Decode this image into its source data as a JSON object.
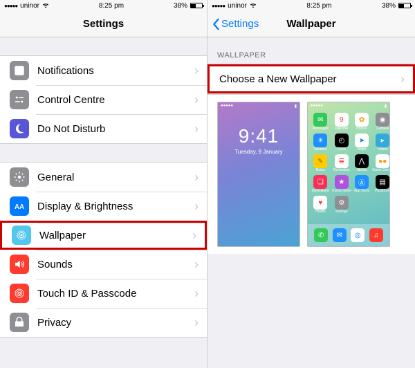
{
  "status": {
    "carrier": "uninor",
    "time": "8:25 pm",
    "battery_pct": "38%"
  },
  "left": {
    "title": "Settings",
    "group1": [
      {
        "label": "Notifications",
        "icon": "notifications-icon",
        "bg": "#8e8e93"
      },
      {
        "label": "Control Centre",
        "icon": "control-centre-icon",
        "bg": "#8e8e93"
      },
      {
        "label": "Do Not Disturb",
        "icon": "dnd-icon",
        "bg": "#5856d6"
      }
    ],
    "group2": [
      {
        "label": "General",
        "icon": "general-icon",
        "bg": "#8e8e93"
      },
      {
        "label": "Display & Brightness",
        "icon": "display-icon",
        "bg": "#007aff"
      },
      {
        "label": "Wallpaper",
        "icon": "wallpaper-icon",
        "bg": "#54c7ec",
        "highlight": true
      },
      {
        "label": "Sounds",
        "icon": "sounds-icon",
        "bg": "#ff3b30"
      },
      {
        "label": "Touch ID & Passcode",
        "icon": "touchid-icon",
        "bg": "#ff3b30"
      },
      {
        "label": "Privacy",
        "icon": "privacy-icon",
        "bg": "#8e8e93"
      }
    ]
  },
  "right": {
    "back_label": "Settings",
    "title": "Wallpaper",
    "section_header": "WALLPAPER",
    "choose_label": "Choose a New Wallpaper",
    "lock_preview": {
      "time": "9:41",
      "date": "Tuesday, 9 January"
    },
    "home_apps": [
      {
        "l": "Messages",
        "c": "#34c759",
        "g": "✉︎"
      },
      {
        "l": "Calendar",
        "c": "#ffffff",
        "g": "9",
        "fg": "#ff3b30"
      },
      {
        "l": "Photos",
        "c": "#ffffff",
        "g": "✿",
        "fg": "#ff9500"
      },
      {
        "l": "Camera",
        "c": "#8e8e93",
        "g": "◉"
      },
      {
        "l": "Weather",
        "c": "#1e90ff",
        "g": "☀︎"
      },
      {
        "l": "Clock",
        "c": "#000000",
        "g": "◴"
      },
      {
        "l": "Maps",
        "c": "#ffffff",
        "g": "➤",
        "fg": "#007aff"
      },
      {
        "l": "Videos",
        "c": "#34aadc",
        "g": "▸"
      },
      {
        "l": "Notes",
        "c": "#ffcc00",
        "g": "✎",
        "fg": "#8b6b00"
      },
      {
        "l": "Reminders",
        "c": "#ffffff",
        "g": "≣",
        "fg": "#ff3b30"
      },
      {
        "l": "Stocks",
        "c": "#000000",
        "g": "⋀"
      },
      {
        "l": "Game Center",
        "c": "#ffffff",
        "g": "●●",
        "fg": "#ff9500"
      },
      {
        "l": "Newsstand",
        "c": "#ff2d55",
        "g": "❏"
      },
      {
        "l": "iTunes Store",
        "c": "#af52de",
        "g": "★"
      },
      {
        "l": "App Store",
        "c": "#1e90ff",
        "g": "Ⓐ"
      },
      {
        "l": "Passbook",
        "c": "#000000",
        "g": "▤"
      },
      {
        "l": "Health",
        "c": "#ffffff",
        "g": "♥︎",
        "fg": "#ff3b30"
      },
      {
        "l": "Settings",
        "c": "#8e8e93",
        "g": "⚙︎"
      }
    ],
    "dock_apps": [
      {
        "l": "Phone",
        "c": "#34c759",
        "g": "✆"
      },
      {
        "l": "Mail",
        "c": "#1e90ff",
        "g": "✉︎"
      },
      {
        "l": "Safari",
        "c": "#ffffff",
        "g": "◎",
        "fg": "#007aff"
      },
      {
        "l": "Music",
        "c": "#ff3b30",
        "g": "♫"
      }
    ]
  }
}
